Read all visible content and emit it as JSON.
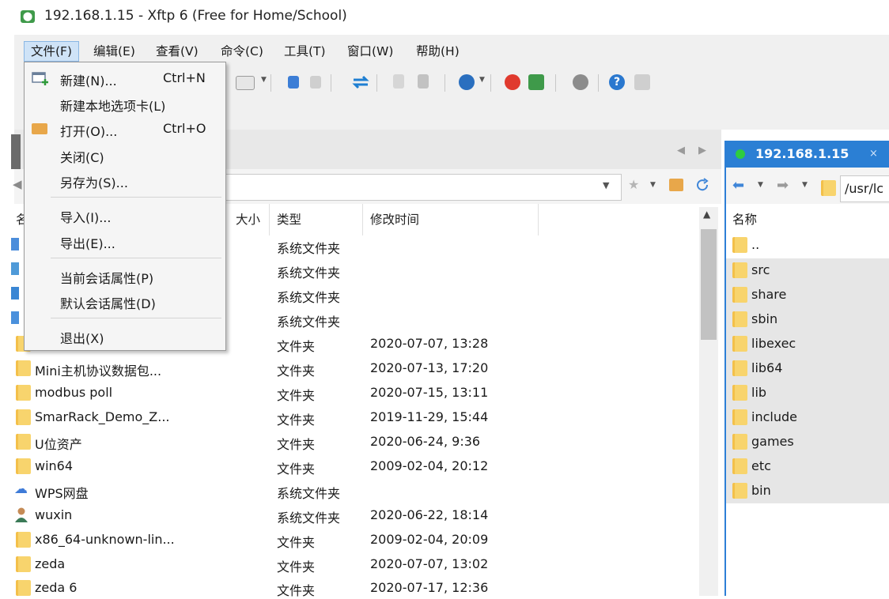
{
  "window": {
    "title": "192.168.1.15 - Xftp 6 (Free for Home/School)",
    "app_icon": "xftp-app-icon"
  },
  "menubar": {
    "items": [
      {
        "label": "文件(F)",
        "active": true
      },
      {
        "label": "编辑(E)"
      },
      {
        "label": "查看(V)"
      },
      {
        "label": "命令(C)"
      },
      {
        "label": "工具(T)"
      },
      {
        "label": "窗口(W)"
      },
      {
        "label": "帮助(H)"
      }
    ]
  },
  "file_menu": {
    "items": [
      {
        "label": "新建(N)...",
        "shortcut": "Ctrl+N",
        "icon": "new-session-icon"
      },
      {
        "label": "新建本地选项卡(L)",
        "shortcut": ""
      },
      {
        "label": "打开(O)...",
        "shortcut": "Ctrl+O",
        "icon": "open-folder-icon"
      },
      {
        "label": "关闭(C)",
        "shortcut": ""
      },
      {
        "label": "另存为(S)...",
        "shortcut": ""
      },
      {
        "label": "导入(I)...",
        "shortcut": ""
      },
      {
        "label": "导出(E)...",
        "shortcut": ""
      },
      {
        "label": "当前会话属性(P)",
        "shortcut": ""
      },
      {
        "label": "默认会话属性(D)",
        "shortcut": ""
      },
      {
        "label": "退出(X)",
        "shortcut": ""
      }
    ]
  },
  "left_pane": {
    "columns": {
      "name": "名",
      "size": "大小",
      "type": "类型",
      "modified": "修改时间"
    },
    "rows": [
      {
        "name": "",
        "type": "系统文件夹",
        "modified": ""
      },
      {
        "name": "",
        "type": "系统文件夹",
        "modified": ""
      },
      {
        "name": "",
        "type": "系统文件夹",
        "modified": ""
      },
      {
        "name": "",
        "type": "系统文件夹",
        "modified": ""
      },
      {
        "name": "",
        "type": "文件夹",
        "modified": "2020-07-07, 13:28"
      },
      {
        "name": "Mini主机协议数据包...",
        "type": "文件夹",
        "modified": "2020-07-13, 17:20"
      },
      {
        "name": "modbus poll",
        "type": "文件夹",
        "modified": "2020-07-15, 13:11"
      },
      {
        "name": "SmarRack_Demo_Z...",
        "type": "文件夹",
        "modified": "2019-11-29, 15:44"
      },
      {
        "name": "U位资产",
        "type": "文件夹",
        "modified": "2020-06-24, 9:36"
      },
      {
        "name": "win64",
        "type": "文件夹",
        "modified": "2009-02-04, 20:12"
      },
      {
        "name": "WPS网盘",
        "type": "系统文件夹",
        "modified": "",
        "icon": "cloud-icon"
      },
      {
        "name": "wuxin",
        "type": "系统文件夹",
        "modified": "2020-06-22, 18:14",
        "icon": "user-icon"
      },
      {
        "name": "x86_64-unknown-lin...",
        "type": "文件夹",
        "modified": "2009-02-04, 20:09"
      },
      {
        "name": "zeda",
        "type": "文件夹",
        "modified": "2020-07-07, 13:02"
      },
      {
        "name": "zeda 6",
        "type": "文件夹",
        "modified": "2020-07-17, 12:36"
      }
    ]
  },
  "right_pane": {
    "tab_label": "192.168.1.15",
    "tab_close": "×",
    "path": "/usr/lc",
    "column_name": "名称",
    "items": [
      "..",
      "src",
      "share",
      "sbin",
      "libexec",
      "lib64",
      "lib",
      "include",
      "games",
      "etc",
      "bin"
    ]
  },
  "colors": {
    "accent": "#2b7fd4",
    "folder": "#f8d46d",
    "connected": "#2ecc40"
  }
}
